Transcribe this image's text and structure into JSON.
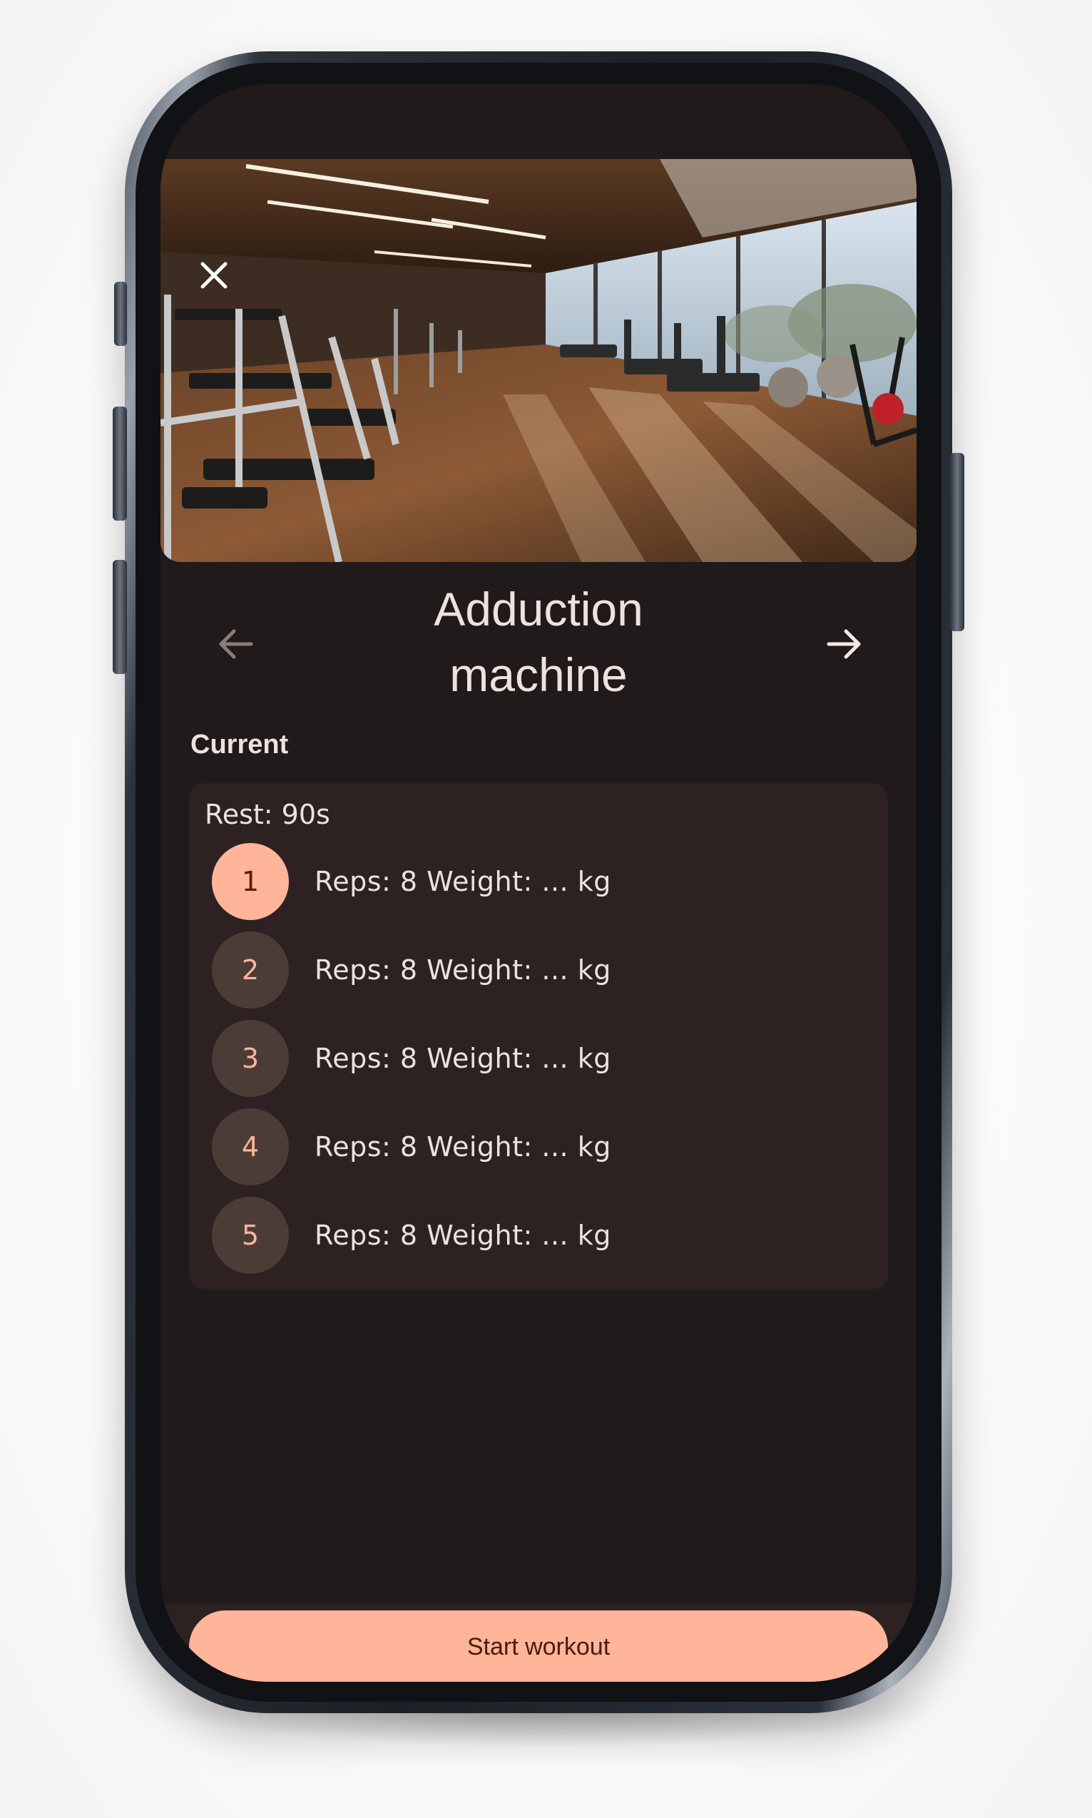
{
  "hero": {
    "image": "gym interior with treadmills, exercise bikes and weight machines",
    "carousel_pages": 3,
    "carousel_active": 1,
    "close_icon": "close-icon"
  },
  "exercise": {
    "title_line1": "Adduction",
    "title_line2": "machine",
    "prev_icon": "arrow-left-icon",
    "next_icon": "arrow-right-icon"
  },
  "section": {
    "label": "Current"
  },
  "card": {
    "rest": "Rest: 90s",
    "sets": [
      {
        "number": "1",
        "text": "Reps: 8 Weight: ... kg",
        "active": true
      },
      {
        "number": "2",
        "text": "Reps: 8 Weight: ... kg",
        "active": false
      },
      {
        "number": "3",
        "text": "Reps: 8 Weight: ... kg",
        "active": false
      },
      {
        "number": "4",
        "text": "Reps: 8 Weight: ... kg",
        "active": false
      },
      {
        "number": "5",
        "text": "Reps: 8 Weight: ... kg",
        "active": false
      }
    ]
  },
  "footer": {
    "button_label": "Start workout"
  },
  "colors": {
    "background": "#211a1a",
    "card": "#2d2221",
    "accent": "#ffb599",
    "text": "#efe2dd"
  }
}
